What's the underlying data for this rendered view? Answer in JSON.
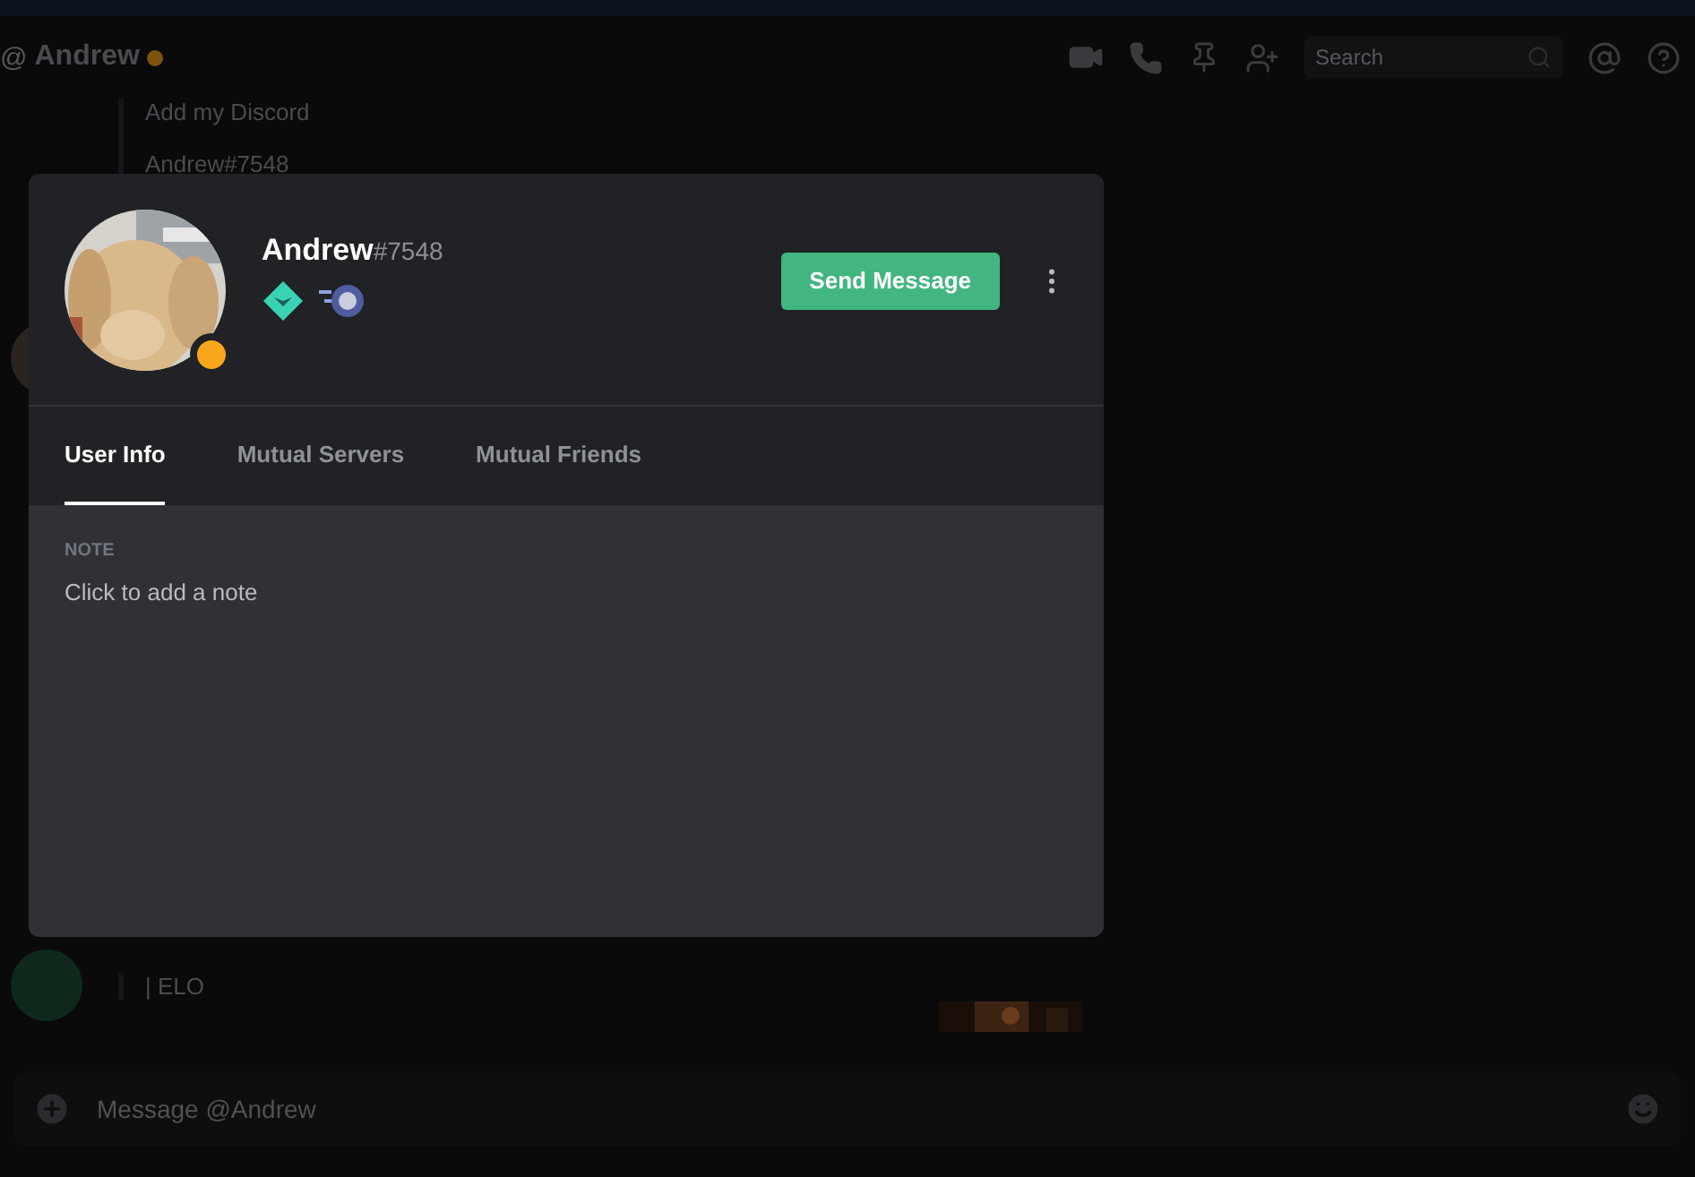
{
  "header": {
    "at_sign": "@",
    "name": "Andrew",
    "idle": true,
    "search": {
      "placeholder": "Search"
    }
  },
  "messages": [
    {
      "kind": "continuation",
      "lines": [
        "Add my Discord",
        "Andrew#7548"
      ]
    },
    {
      "kind": "photo-avatar"
    },
    {
      "kind": "green-avatar",
      "lines": [
        "| ELO"
      ],
      "attachment": {
        "kind": "picture"
      }
    }
  ],
  "composer": {
    "placeholder": "Message @Andrew"
  },
  "profile": {
    "avatar": {
      "kind": "picture"
    },
    "idle": true,
    "username": "Andrew",
    "discriminator": "#7548",
    "action": "Send Message",
    "tabs": [
      {
        "label": "User Info",
        "selected": true
      },
      {
        "label": "Mutual Servers",
        "selected": false
      },
      {
        "label": "Mutual Friends",
        "selected": false
      }
    ],
    "note": {
      "label": "NOTE",
      "placeholder": "Click to add a note"
    }
  }
}
